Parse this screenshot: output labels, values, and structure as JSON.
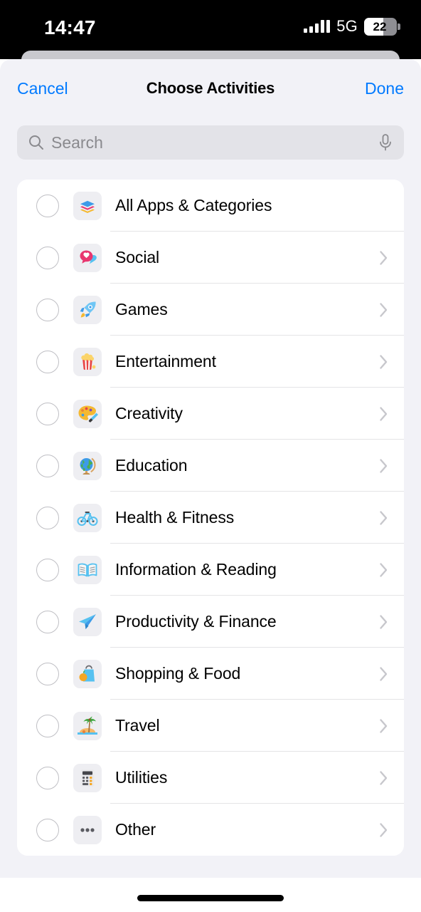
{
  "status_bar": {
    "time": "14:47",
    "network": "5G",
    "battery_percent": "22",
    "signal_icon": "cellular-bars-icon",
    "battery_icon": "battery-icon"
  },
  "nav": {
    "cancel_label": "Cancel",
    "title": "Choose Activities",
    "done_label": "Done",
    "accent_color": "#007aff"
  },
  "search": {
    "placeholder": "Search",
    "value": "",
    "search_icon": "search-icon",
    "mic_icon": "microphone-icon"
  },
  "list": {
    "items": [
      {
        "label": "All Apps & Categories",
        "icon": "layers-stack-icon",
        "selected": false,
        "has_chevron": false
      },
      {
        "label": "Social",
        "icon": "speech-bubble-heart-icon",
        "selected": false,
        "has_chevron": true
      },
      {
        "label": "Games",
        "icon": "rocket-icon",
        "selected": false,
        "has_chevron": true
      },
      {
        "label": "Entertainment",
        "icon": "popcorn-icon",
        "selected": false,
        "has_chevron": true
      },
      {
        "label": "Creativity",
        "icon": "artist-palette-icon",
        "selected": false,
        "has_chevron": true
      },
      {
        "label": "Education",
        "icon": "globe-stand-icon",
        "selected": false,
        "has_chevron": true
      },
      {
        "label": "Health & Fitness",
        "icon": "bicycle-icon",
        "selected": false,
        "has_chevron": true
      },
      {
        "label": "Information & Reading",
        "icon": "open-book-icon",
        "selected": false,
        "has_chevron": true
      },
      {
        "label": "Productivity & Finance",
        "icon": "paper-plane-icon",
        "selected": false,
        "has_chevron": true
      },
      {
        "label": "Shopping & Food",
        "icon": "shopping-bag-icon",
        "selected": false,
        "has_chevron": true
      },
      {
        "label": "Travel",
        "icon": "palm-island-icon",
        "selected": false,
        "has_chevron": true
      },
      {
        "label": "Utilities",
        "icon": "calculator-icon",
        "selected": false,
        "has_chevron": true
      },
      {
        "label": "Other",
        "icon": "ellipsis-icon",
        "selected": false,
        "has_chevron": true
      }
    ]
  },
  "colors": {
    "sheet_background": "#f2f2f7",
    "card_background": "#ffffff",
    "separator": "#e4e4e6",
    "chevron": "#c7c7cc",
    "tile_background": "#eeeef2",
    "radio_border": "#bfbfc4",
    "search_background": "#e3e3e8"
  },
  "home_indicator": {
    "name": "home-indicator"
  }
}
